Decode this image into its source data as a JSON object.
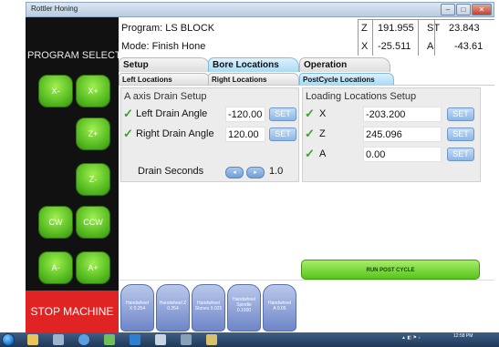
{
  "window": {
    "title": "Rottler Honing"
  },
  "left_panel": {
    "section_label": "PROGRAM SELECT",
    "jog_buttons": [
      "X-",
      "X+",
      "Z+",
      "Z-",
      "CW",
      "CCW",
      "A-",
      "A+"
    ],
    "stop_label": "STOP MACHINE"
  },
  "header": {
    "program": "Program: LS BLOCK",
    "mode": "Mode: Finish Hone",
    "coords": {
      "z_label": "Z",
      "z_value": "191.955",
      "st_label": "ST",
      "st_value": "23.843",
      "x_label": "X",
      "x_value": "-25.511",
      "a_label": "A",
      "a_value": "-43.61"
    }
  },
  "tabs": [
    "Setup",
    "Bore Locations",
    "Operation"
  ],
  "subtabs": [
    "Left Locations",
    "Right Locations",
    "PostCycle Locations"
  ],
  "drain": {
    "title": "A axis Drain Setup",
    "left_label": "Left Drain Angle",
    "left_value": "-120.00",
    "right_label": "Right Drain Angle",
    "right_value": "120.00",
    "seconds_label": "Drain Seconds",
    "seconds_value": "1.0",
    "set_label": "SET"
  },
  "loading": {
    "title": "Loading Locations Setup",
    "rows": [
      {
        "axis": "X",
        "value": "-203.200"
      },
      {
        "axis": "Z",
        "value": "245.096"
      },
      {
        "axis": "A",
        "value": "0.00"
      }
    ],
    "set_label": "SET"
  },
  "run_post_cycle": "RUN POST CYCLE",
  "handwheels": [
    {
      "line1": "Handwheel",
      "line2": "X 0.254"
    },
    {
      "line1": "Handwheel Z",
      "line2": "0.254"
    },
    {
      "line1": "Handwheel",
      "line2": "Stones 0.025"
    },
    {
      "line1": "Handwheel Spindle",
      "line2": "0.1000"
    },
    {
      "line1": "Handwheel",
      "line2": "A 0.05"
    }
  ],
  "taskbar": {
    "time": "12:58 PM"
  },
  "colors": {
    "accent_green": "#58c41c",
    "stop_red": "#e02424",
    "tab_active": "#a8dbf5"
  }
}
